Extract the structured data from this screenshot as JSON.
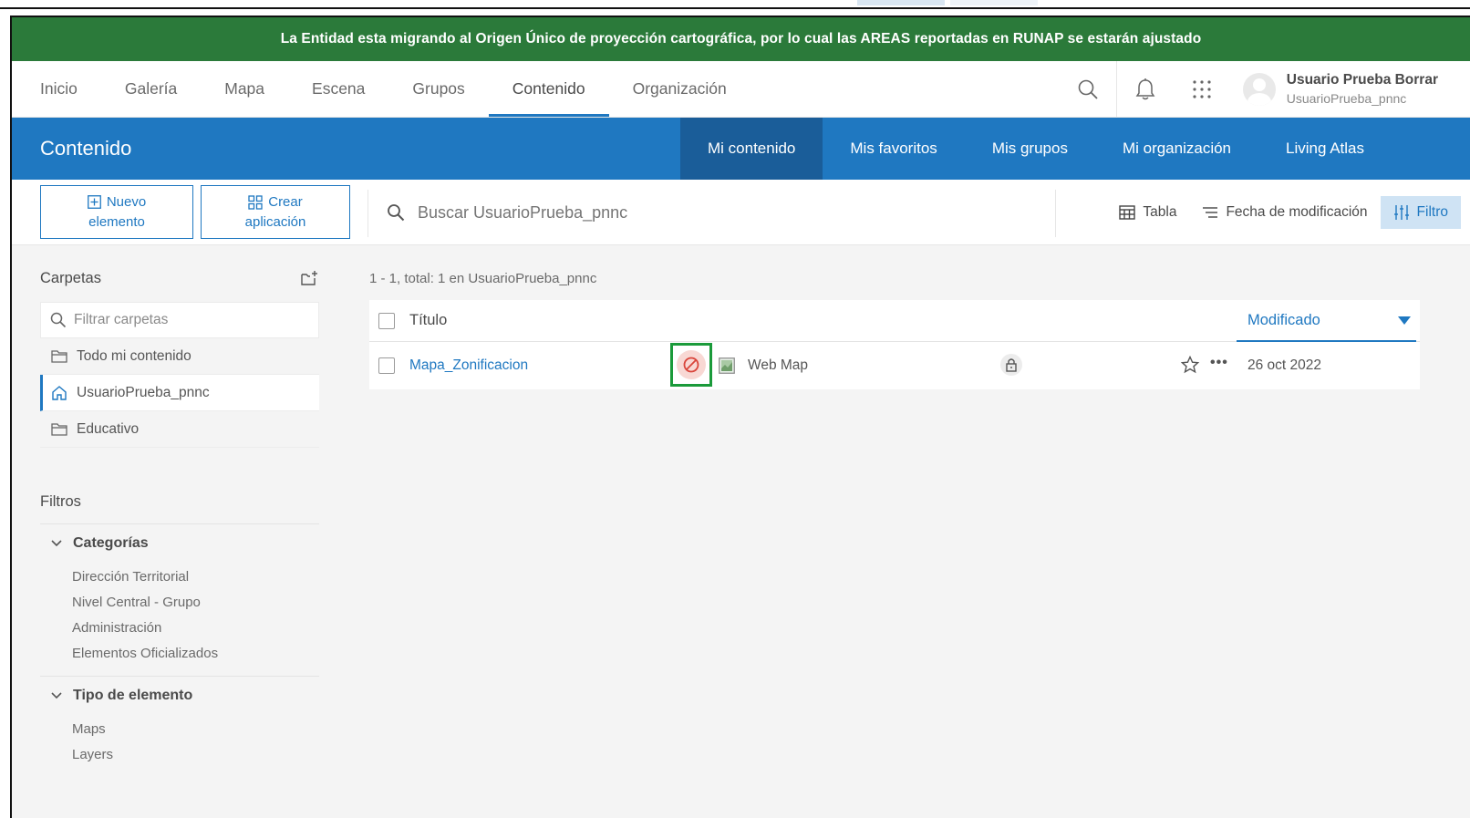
{
  "banner": {
    "text": "La Entidad esta migrando al Origen Único de proyección cartográfica, por lo cual las AREAS reportadas en RUNAP se estarán ajustado"
  },
  "topnav": {
    "items": [
      {
        "label": "Inicio"
      },
      {
        "label": "Galería"
      },
      {
        "label": "Mapa"
      },
      {
        "label": "Escena"
      },
      {
        "label": "Grupos"
      },
      {
        "label": "Contenido",
        "active": true
      },
      {
        "label": "Organización"
      }
    ],
    "user": {
      "name": "Usuario Prueba Borrar",
      "login": "UsuarioPrueba_pnnc"
    }
  },
  "content_bar": {
    "title": "Contenido",
    "tabs": [
      {
        "label": "Mi contenido",
        "active": true
      },
      {
        "label": "Mis favoritos"
      },
      {
        "label": "Mis grupos"
      },
      {
        "label": "Mi organización"
      },
      {
        "label": "Living Atlas"
      }
    ]
  },
  "toolbar": {
    "new_item_line1": "Nuevo",
    "new_item_line2": "elemento",
    "create_app_line1": "Crear",
    "create_app_line2": "aplicación",
    "search_placeholder": "Buscar UsuarioPrueba_pnnc",
    "table_label": "Tabla",
    "sort_label": "Fecha de modificación",
    "filter_label": "Filtro"
  },
  "sidebar": {
    "folders_title": "Carpetas",
    "filter_placeholder": "Filtrar carpetas",
    "folders": [
      {
        "label": "Todo mi contenido",
        "icon": "folder-icon"
      },
      {
        "label": "UsuarioPrueba_pnnc",
        "icon": "home-icon",
        "active": true
      },
      {
        "label": "Educativo",
        "icon": "folder-icon"
      }
    ],
    "filters_title": "Filtros",
    "categories": {
      "title": "Categorías",
      "items": [
        "Dirección Territorial",
        "Nivel Central - Grupo",
        "Administración",
        "Elementos Oficializados"
      ]
    },
    "item_type": {
      "title": "Tipo de elemento",
      "items": [
        "Maps",
        "Layers"
      ]
    }
  },
  "results": {
    "count_text": "1 - 1, total: 1 en UsuarioPrueba_pnnc",
    "columns": {
      "title": "Título",
      "modified": "Modificado"
    },
    "rows": [
      {
        "title": "Mapa_Zonificacion",
        "type": "Web Map",
        "modified": "26 oct 2022"
      }
    ]
  },
  "colors": {
    "banner_green": "#2b7a3a",
    "accent_blue": "#1f78c1",
    "tab_active_blue": "#1a5d99",
    "highlight_green": "#1a9a3a"
  }
}
